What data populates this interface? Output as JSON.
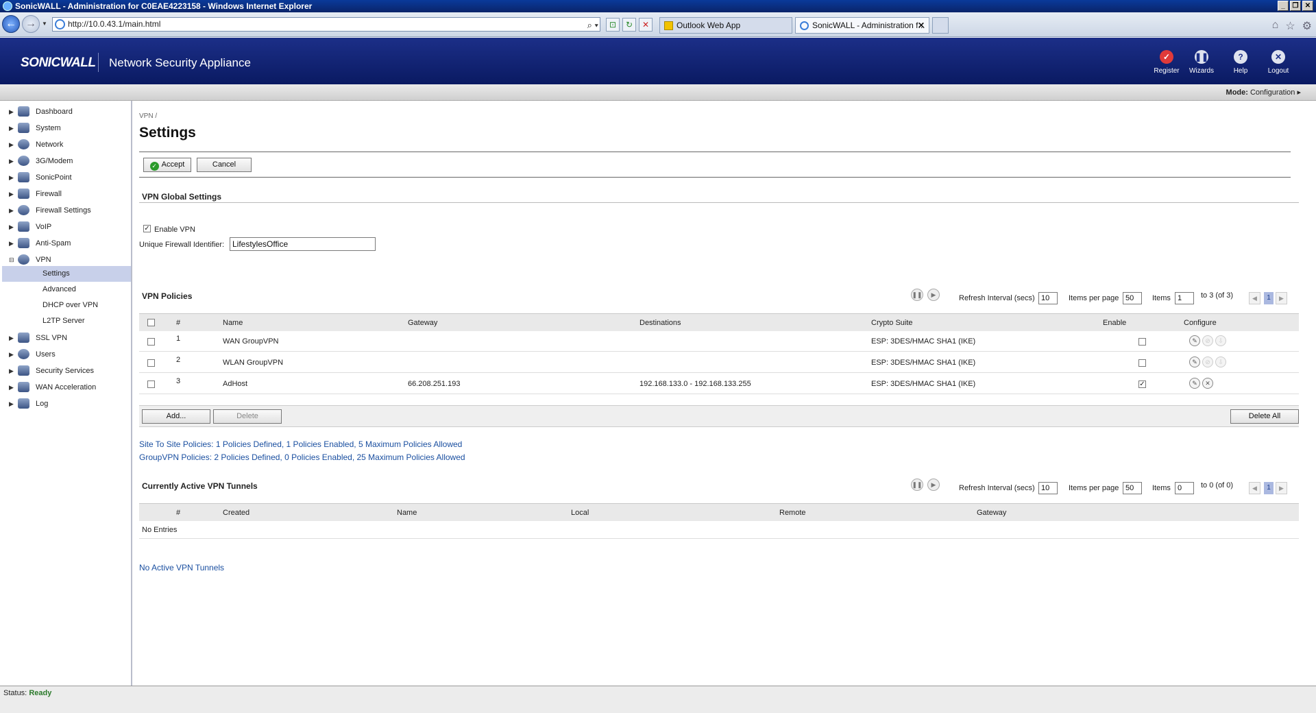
{
  "window": {
    "title": "SonicWALL - Administration for C0EAE4223158 - Windows Internet Explorer"
  },
  "browser": {
    "url": "http://10.0.43.1/main.html",
    "tabs": [
      {
        "label": "Outlook Web App"
      },
      {
        "label": "SonicWALL - Administration f..."
      }
    ]
  },
  "header": {
    "logo": "SONICWALL",
    "product": "Network Security Appliance",
    "buttons": [
      {
        "label": "Register",
        "icon": "check-badge-icon"
      },
      {
        "label": "Wizards",
        "icon": "wizard-icon"
      },
      {
        "label": "Help",
        "icon": "help-icon"
      },
      {
        "label": "Logout",
        "icon": "logout-icon"
      }
    ]
  },
  "modebar": {
    "mode_label": "Mode:",
    "mode_value": "Configuration ▸"
  },
  "sidebar": {
    "items": [
      {
        "label": "Dashboard"
      },
      {
        "label": "System"
      },
      {
        "label": "Network"
      },
      {
        "label": "3G/Modem"
      },
      {
        "label": "SonicPoint"
      },
      {
        "label": "Firewall"
      },
      {
        "label": "Firewall Settings"
      },
      {
        "label": "VoIP"
      },
      {
        "label": "Anti-Spam"
      },
      {
        "label": "VPN"
      },
      {
        "label": "SSL VPN"
      },
      {
        "label": "Users"
      },
      {
        "label": "Security Services"
      },
      {
        "label": "WAN Acceleration"
      },
      {
        "label": "Log"
      }
    ],
    "vpn_sub": [
      {
        "label": "Settings"
      },
      {
        "label": "Advanced"
      },
      {
        "label": "DHCP over VPN"
      },
      {
        "label": "L2TP Server"
      }
    ]
  },
  "main": {
    "breadcrumb": "VPN /",
    "title": "Settings",
    "accept": "Accept",
    "cancel": "Cancel",
    "global": {
      "title": "VPN Global Settings",
      "enable_vpn": "Enable VPN",
      "fid_label": "Unique Firewall Identifier:",
      "fid_value": "LifestylesOffice"
    },
    "policies": {
      "title": "VPN Policies",
      "refresh_label": "Refresh Interval (secs)",
      "refresh_value": "10",
      "ipp_label": "Items per page",
      "ipp_value": "50",
      "items_label": "Items",
      "items_value": "1",
      "range": "to 3 (of 3)",
      "page": "1",
      "columns": [
        "#",
        "Name",
        "Gateway",
        "Destinations",
        "Crypto Suite",
        "Enable",
        "Configure"
      ],
      "rows": [
        {
          "num": "1",
          "name": "WAN GroupVPN",
          "gateway": "",
          "destinations": "",
          "crypto": "ESP: 3DES/HMAC SHA1 (IKE)",
          "enabled": ""
        },
        {
          "num": "2",
          "name": "WLAN GroupVPN",
          "gateway": "",
          "destinations": "",
          "crypto": "ESP: 3DES/HMAC SHA1 (IKE)",
          "enabled": ""
        },
        {
          "num": "3",
          "name": "AdHost",
          "gateway": "66.208.251.193",
          "destinations": "192.168.133.0 - 192.168.133.255",
          "crypto": "ESP: 3DES/HMAC SHA1 (IKE)",
          "enabled": "✓"
        }
      ],
      "add": "Add...",
      "delete": "Delete",
      "delete_all": "Delete All",
      "site_note": "Site To Site Policies: 1 Policies Defined, 1 Policies Enabled, 5 Maximum Policies Allowed",
      "group_note": "GroupVPN Policies: 2 Policies Defined, 0 Policies Enabled, 25 Maximum Policies Allowed"
    },
    "tunnels": {
      "title": "Currently Active VPN Tunnels",
      "refresh_label": "Refresh Interval (secs)",
      "refresh_value": "10",
      "ipp_label": "Items per page",
      "ipp_value": "50",
      "items_label": "Items",
      "items_value": "0",
      "range": "to 0 (of 0)",
      "page": "1",
      "columns": [
        "#",
        "Created",
        "Name",
        "Local",
        "Remote",
        "Gateway"
      ],
      "empty": "No Entries",
      "note": "No Active VPN Tunnels"
    }
  },
  "status": {
    "label": "Status:",
    "value": "Ready"
  }
}
